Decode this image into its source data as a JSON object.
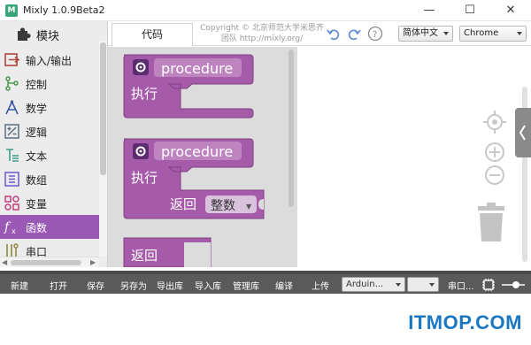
{
  "window": {
    "title": "Mixly 1.0.9Beta2",
    "minimize": "—",
    "maximize": "☐",
    "close": "✕"
  },
  "sidebar": {
    "header": "模块",
    "items": [
      {
        "label": "输入/输出",
        "icon": "io-icon",
        "color": "#b0453f"
      },
      {
        "label": "控制",
        "icon": "control-icon",
        "color": "#4c9a4c"
      },
      {
        "label": "数学",
        "icon": "math-icon",
        "color": "#3a5aa5"
      },
      {
        "label": "逻辑",
        "icon": "logic-icon",
        "color": "#5b6f7e"
      },
      {
        "label": "文本",
        "icon": "text-icon",
        "color": "#3f9b86"
      },
      {
        "label": "数组",
        "icon": "array-icon",
        "color": "#6a5acd"
      },
      {
        "label": "变量",
        "icon": "variable-icon",
        "color": "#c2407a"
      },
      {
        "label": "函数",
        "icon": "function-icon",
        "color": "#9b59b6",
        "active": true
      },
      {
        "label": "串口",
        "icon": "serial-icon",
        "color": "#8a8a3a"
      }
    ]
  },
  "tabs": {
    "code": "代码"
  },
  "copyright": {
    "line1": "Copyright © 北京师范大学米思齐",
    "line2": "团队 http://mixly.org/"
  },
  "language": {
    "value": "简体中文"
  },
  "browser": {
    "value": "Chrome"
  },
  "blocks": {
    "b1": {
      "name": "procedure",
      "do_label": "执行"
    },
    "b2": {
      "name": "procedure",
      "do_label": "执行",
      "return_label": "返回",
      "return_type": "整数"
    },
    "b3": {
      "return_label": "返回"
    }
  },
  "toolbar": {
    "new": "新建",
    "open": "打开",
    "save": "保存",
    "save_as": "另存为",
    "export_lib": "导出库",
    "import_lib": "导入库",
    "manage_lib": "管理库",
    "compile": "编译",
    "upload": "上传",
    "board": "Arduin...",
    "port": "",
    "serial": "串口..."
  },
  "watermark": "ITMOP.COM",
  "colors": {
    "procedure_block": "#a55ba9",
    "procedure_dark": "#7e3f82",
    "accent_active": "#9b59b6"
  }
}
